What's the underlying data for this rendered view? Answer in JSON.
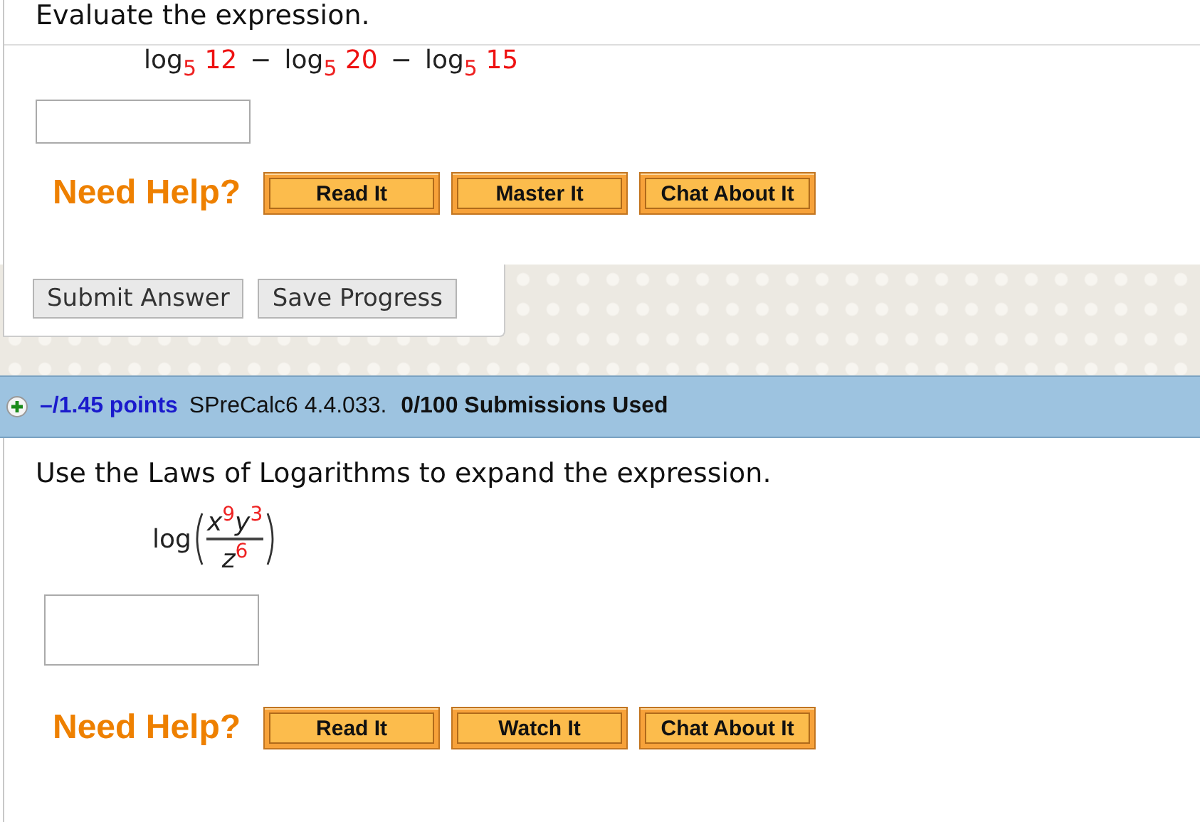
{
  "question_1": {
    "prompt": "Evaluate the expression.",
    "expression": {
      "operator": "−",
      "terms": [
        {
          "func": "log",
          "base": "5",
          "arg": "12"
        },
        {
          "func": "log",
          "base": "5",
          "arg": "20"
        },
        {
          "func": "log",
          "base": "5",
          "arg": "15"
        }
      ]
    },
    "help": {
      "label": "Need Help?",
      "buttons": [
        "Read It",
        "Master It",
        "Chat About It"
      ]
    },
    "actions": [
      "Submit Answer",
      "Save Progress"
    ]
  },
  "question_2": {
    "header": {
      "points": "–/1.45 points",
      "source": "SPreCalc6 4.4.033.",
      "submissions": "0/100 Submissions Used"
    },
    "prompt": "Use the Laws of Logarithms to expand the expression.",
    "expression": {
      "func": "log",
      "numerator": [
        {
          "var": "x",
          "exp": "9"
        },
        {
          "var": "y",
          "exp": "3"
        }
      ],
      "denominator": [
        {
          "var": "z",
          "exp": "6"
        }
      ]
    },
    "help": {
      "label": "Need Help?",
      "buttons": [
        "Read It",
        "Watch It",
        "Chat About It"
      ]
    }
  }
}
